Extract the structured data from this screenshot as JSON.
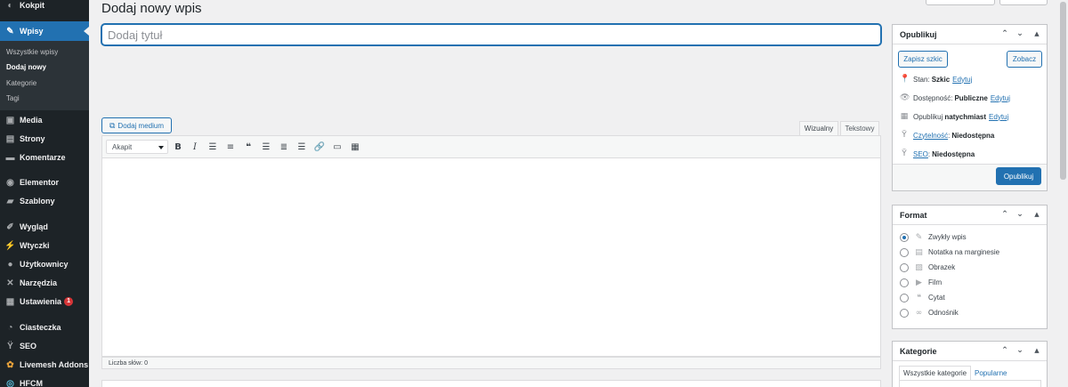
{
  "sidebar": {
    "items": [
      {
        "label": "Kokpit",
        "icon": "dashboard-icon"
      },
      {
        "label": "Wpisy",
        "icon": "pin-icon"
      },
      {
        "label": "Media",
        "icon": "media-icon"
      },
      {
        "label": "Strony",
        "icon": "page-icon"
      },
      {
        "label": "Komentarze",
        "icon": "comment-icon"
      },
      {
        "label": "Elementor",
        "icon": "elementor-icon"
      },
      {
        "label": "Szablony",
        "icon": "folder-icon"
      },
      {
        "label": "Wygląd",
        "icon": "brush-icon"
      },
      {
        "label": "Wtyczki",
        "icon": "plugin-icon"
      },
      {
        "label": "Użytkownicy",
        "icon": "users-icon"
      },
      {
        "label": "Narzędzia",
        "icon": "wrench-icon"
      },
      {
        "label": "Ustawienia",
        "icon": "settings-icon",
        "badge": "1"
      },
      {
        "label": "Ciasteczka",
        "icon": "cookie-icon"
      },
      {
        "label": "SEO",
        "icon": "yoast-icon"
      },
      {
        "label": "Livemesh Addons",
        "icon": "livemesh-icon"
      },
      {
        "label": "HFCM",
        "icon": "hfcm-icon"
      }
    ],
    "submenu": [
      "Wszystkie wpisy",
      "Dodaj nowy",
      "Kategorie",
      "Tagi"
    ]
  },
  "header": {
    "title": "Dodaj nowy wpis"
  },
  "title_field": {
    "placeholder": "Dodaj tytuł",
    "value": ""
  },
  "editor": {
    "add_media_label": "Dodaj medium",
    "tabs": [
      "Wizualny",
      "Tekstowy"
    ],
    "format_select": "Akapit",
    "word_count": "Liczba słów: 0"
  },
  "publish_box": {
    "title": "Opublikuj",
    "save_draft": "Zapisz szkic",
    "preview": "Zobacz",
    "status_label": "Stan:",
    "status_value": "Szkic",
    "visibility_label": "Dostępność:",
    "visibility_value": "Publiczne",
    "schedule_label": "Opublikuj",
    "schedule_value": "natychmiast",
    "edit_link": "Edytuj",
    "readability_link": "Czytelność",
    "readability_value": "Niedostępna",
    "seo_link": "SEO",
    "seo_value": "Niedostępna",
    "publish_button": "Opublikuj"
  },
  "format_box": {
    "title": "Format",
    "options": [
      {
        "label": "Zwykły wpis",
        "icon": "pin-icon",
        "checked": true
      },
      {
        "label": "Notatka na marginesie",
        "icon": "aside-icon",
        "checked": false
      },
      {
        "label": "Obrazek",
        "icon": "image-icon",
        "checked": false
      },
      {
        "label": "Film",
        "icon": "video-icon",
        "checked": false
      },
      {
        "label": "Cytat",
        "icon": "quote-icon",
        "checked": false
      },
      {
        "label": "Odnośnik",
        "icon": "link-icon",
        "checked": false
      }
    ]
  },
  "category_box": {
    "title": "Kategorie",
    "tabs": [
      "Wszystkie kategorie",
      "Popularne"
    ]
  },
  "colors": {
    "accent": "#2271b1",
    "sidebar_bg": "#1d2327",
    "badge": "#d63638"
  }
}
